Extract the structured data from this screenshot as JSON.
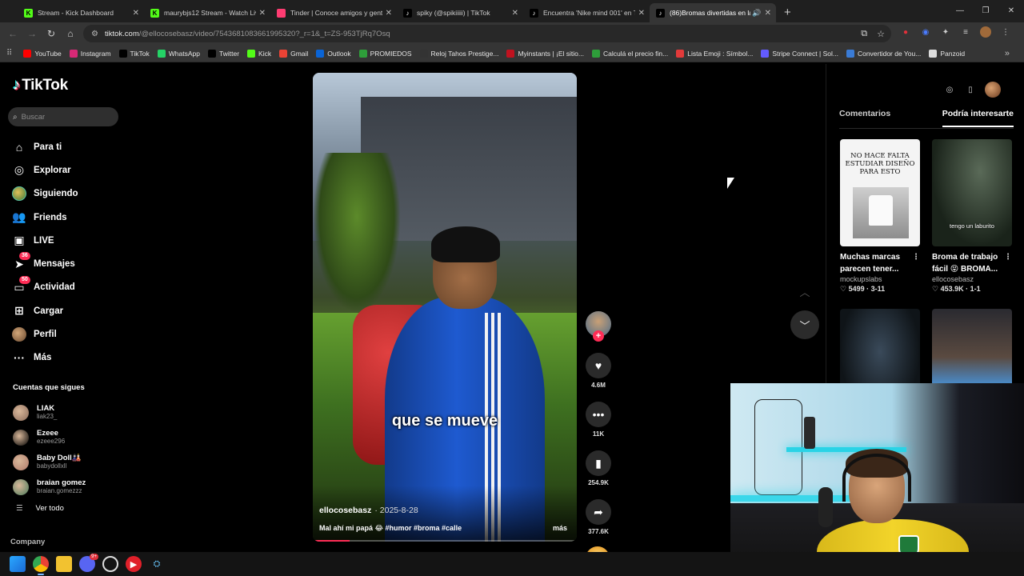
{
  "browser": {
    "tabs": [
      {
        "label": "Stream - Kick Dashboard",
        "icon": "kick-icon",
        "active": false
      },
      {
        "label": "maurybjs12 Stream - Watch Live",
        "icon": "kick-icon",
        "active": false
      },
      {
        "label": "Tinder | Conoce amigos y gente",
        "icon": "tinder-icon",
        "active": false
      },
      {
        "label": "spiky (@spikiiiii) | TikTok",
        "icon": "tiktok-icon",
        "active": false
      },
      {
        "label": "Encuentra 'Nike mind 001' en TikTok",
        "icon": "tiktok-icon",
        "active": false
      },
      {
        "label": "(86)Bromas divertidas en la calle",
        "icon": "tiktok-icon",
        "active": true
      }
    ],
    "url_host": "tiktok.com",
    "url_path": "/@ellocosebasz/video/7543681083661995320?_r=1&_t=ZS-953TjRq7Osq",
    "bookmarks": [
      {
        "label": "YouTube",
        "color": "#ff0000"
      },
      {
        "label": "Instagram",
        "color": "#d62976"
      },
      {
        "label": "TikTok",
        "color": "#000000"
      },
      {
        "label": "WhatsApp",
        "color": "#25d366"
      },
      {
        "label": "Twitter",
        "color": "#000000"
      },
      {
        "label": "Kick",
        "color": "#53fc18"
      },
      {
        "label": "Gmail",
        "color": "#ea4335"
      },
      {
        "label": "Outlook",
        "color": "#0a64d6"
      },
      {
        "label": "PROMIEDOS",
        "color": "#2e9e3a"
      },
      {
        "label": "Reloj Tahos Prestige...",
        "color": "#333333"
      },
      {
        "label": "Myinstants | ¡El sitio...",
        "color": "#c0121f"
      },
      {
        "label": "Calculá el precio fin...",
        "color": "#2e9e3a"
      },
      {
        "label": "Lista Emoji : Símbol...",
        "color": "#e23a3a"
      },
      {
        "label": "Stripe Connect | Sol...",
        "color": "#635bff"
      },
      {
        "label": "Convertidor de You...",
        "color": "#3a7bd5"
      },
      {
        "label": "Panzoid",
        "color": "#dddddd"
      }
    ]
  },
  "tiktok": {
    "logo": "TikTok",
    "search_placeholder": "Buscar",
    "nav": [
      {
        "label": "Para ti",
        "icon": "home-icon",
        "glyph": "⌂"
      },
      {
        "label": "Explorar",
        "icon": "compass-icon",
        "glyph": "◎"
      },
      {
        "label": "Siguiendo",
        "icon": "following-avatar-icon",
        "glyph": ""
      },
      {
        "label": "Friends",
        "icon": "friends-icon",
        "glyph": "👥"
      },
      {
        "label": "LIVE",
        "icon": "live-icon",
        "glyph": "▣"
      },
      {
        "label": "Mensajes",
        "icon": "messages-icon",
        "glyph": "➤",
        "badge": "36"
      },
      {
        "label": "Actividad",
        "icon": "activity-icon",
        "glyph": "▭",
        "badge": "50"
      },
      {
        "label": "Cargar",
        "icon": "upload-icon",
        "glyph": "⊞"
      },
      {
        "label": "Perfil",
        "icon": "profile-avatar-icon",
        "glyph": ""
      },
      {
        "label": "Más",
        "icon": "more-icon",
        "glyph": "···"
      }
    ],
    "following_title": "Cuentas que sigues",
    "following": [
      {
        "name": "LIAK",
        "handle": "liak23_",
        "color": "#8a6a5a"
      },
      {
        "name": "Ezeee",
        "handle": "ezeee296",
        "color": "#000000"
      },
      {
        "name": "Baby Doll🎎",
        "handle": "babydollxll",
        "color": "#b07a6a"
      },
      {
        "name": "braian gomez",
        "handle": "braian.gomezzz",
        "color": "#4a7a5a"
      }
    ],
    "see_all": "Ver todo",
    "company": "Company"
  },
  "video": {
    "caption": "que se mueve",
    "author": "ellocosebasz",
    "date": "· 2025-8-28",
    "description": "Mal ahí mi papá 😂 #humor #broma #calle",
    "more": "más",
    "progress": 0.14,
    "likes": "4.6M",
    "comments": "11K",
    "saves": "254.9K",
    "shares": "377.6K"
  },
  "right_panel": {
    "tab_comments": "Comentarios",
    "tab_interesting": "Podría interesarte",
    "cards": [
      {
        "title": "Muchas marcas parecen tener...",
        "user": "mockupslabs",
        "likes": "5499",
        "date": "3-11",
        "thumb_text": "NO HACE FALTA ESTUDIAR DISEÑO PARA ESTO"
      },
      {
        "title": "Broma de trabajo fácil 😝 BROMA...",
        "user": "ellocosebasz",
        "likes": "453.9K",
        "date": "1-1",
        "thumb_text": "tengo un laburito"
      },
      {
        "title": "",
        "user": "",
        "likes": "",
        "date": "",
        "thumb_text": ""
      },
      {
        "title": "",
        "user": "",
        "likes": "",
        "date": "",
        "thumb_text": ""
      }
    ]
  },
  "taskbar": {
    "discord_badge": "9+"
  }
}
